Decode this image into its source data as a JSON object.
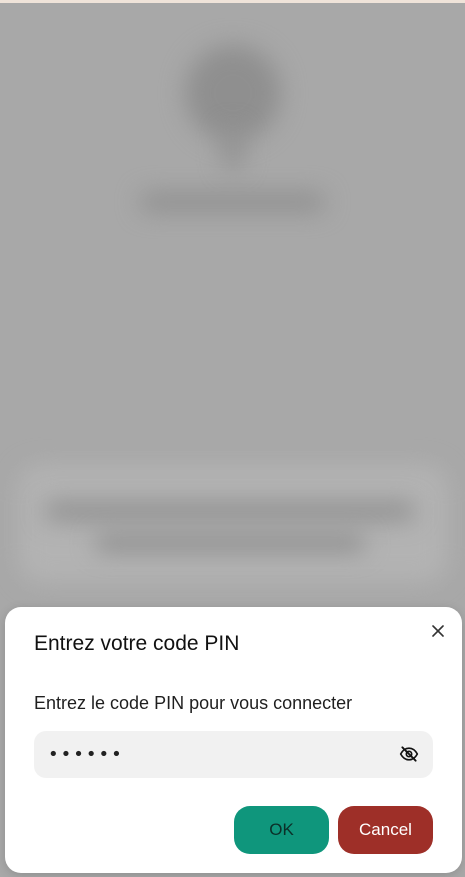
{
  "dialog": {
    "title": "Entrez votre code PIN",
    "subtitle": "Entrez le code PIN pour vous connecter",
    "pin_value": "••••••",
    "close_icon": "close-icon",
    "visibility_icon": "eye-off-icon",
    "buttons": {
      "ok_label": "OK",
      "cancel_label": "Cancel"
    }
  },
  "colors": {
    "ok": "#0f967c",
    "cancel": "#9e2f28",
    "field_bg": "#f1f1f1",
    "overlay": "#a8a8a8"
  }
}
